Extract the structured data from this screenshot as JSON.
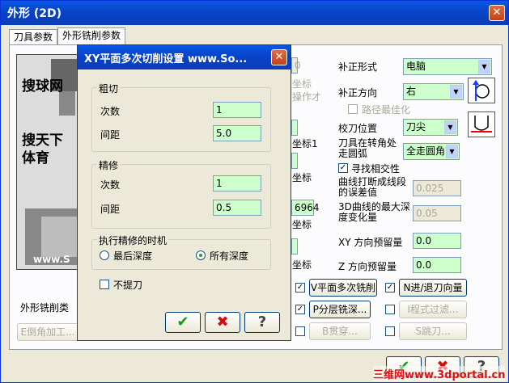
{
  "window": {
    "title": "外形 (2D)",
    "close_glyph": "✕"
  },
  "tabs": [
    {
      "label": "刀具参数"
    },
    {
      "label": "外形铣削参数"
    }
  ],
  "preview": {
    "line1": "搜球网",
    "line2": "搜天下体育",
    "watermark": "www.S",
    "caption": "外形铣削类",
    "chamfer_button": "E倒角加工..."
  },
  "behind_fragments": {
    "f1": "0",
    "f2": "坐标",
    "f3": "操作才",
    "f4": "坐标1",
    "f5": "坐标",
    "f6": "6964",
    "f7": "坐标",
    "f8": "坐标"
  },
  "right": {
    "comp_form_label": "补正形式",
    "comp_form_value": "电脑",
    "comp_dir_label": "补正方向",
    "comp_dir_value": "右",
    "path_opt_label": "路径最佳化",
    "tip_pos_label": "校刀位置",
    "tip_pos_value": "刀尖",
    "corner_label": "刀具在转角处走圆弧",
    "corner_value": "全走圆角",
    "find_intersect_label": "寻找相交性",
    "break_tol_label": "曲线打断成线段的误差值",
    "break_tol_value": "0.025",
    "depth_var_label": "3D曲线的最大深度变化量",
    "depth_var_value": "0.05",
    "xy_stock_label": "XY 方向预留量",
    "xy_stock_value": "0.0",
    "z_stock_label": "Z 方向预留量",
    "z_stock_value": "0.0"
  },
  "bottom_buttons": {
    "multi_pass": "V平面多次铣削",
    "lead_in_out": "N进/退刀向量",
    "depth_cuts": "P分层铣深...",
    "filter": "I程式过滤...",
    "penetrate": "B贯穿...",
    "jump": "S跳刀..."
  },
  "dialog": {
    "title": "XY平面多次切削设置  www.So...",
    "rough_group": "粗切",
    "rough_count_label": "次数",
    "rough_count_value": "1",
    "rough_spacing_label": "间距",
    "rough_spacing_value": "5.0",
    "finish_group": "精修",
    "finish_count_label": "次数",
    "finish_count_value": "1",
    "finish_spacing_label": "间距",
    "finish_spacing_value": "0.5",
    "timing_group": "执行精修的时机",
    "timing_last": "最后深度",
    "timing_all": "所有深度",
    "no_lift_label": "不提刀",
    "ok_glyph": "✔",
    "cancel_glyph": "✖",
    "help_glyph": "?"
  },
  "main_ok_glyph": "✔",
  "main_cancel_glyph": "✖",
  "main_help_glyph": "?",
  "site_watermark": "三维网www.3dportal.cn"
}
